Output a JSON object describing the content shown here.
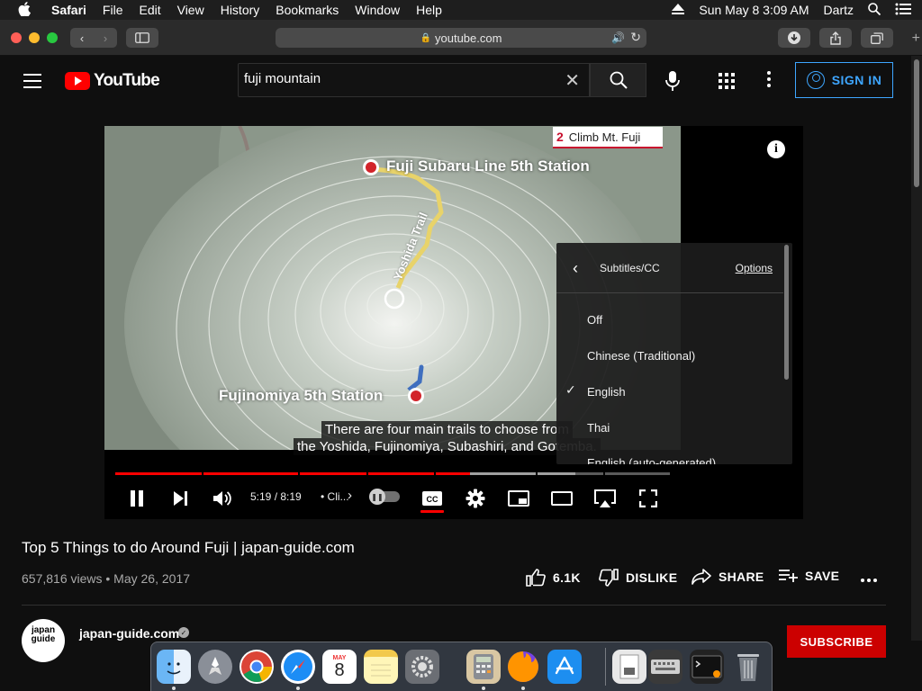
{
  "menubar": {
    "items": [
      "Safari",
      "File",
      "Edit",
      "View",
      "History",
      "Bookmarks",
      "Window",
      "Help"
    ],
    "clock": "Sun May 8  3:09 AM",
    "user": "Dartz"
  },
  "browser": {
    "url": "youtube.com"
  },
  "header": {
    "logo_text": "YouTube",
    "search_value": "fuji mountain",
    "signin_label": "SIGN IN"
  },
  "video": {
    "step_number": "2",
    "step_label": "Climb Mt. Fuji",
    "map_labels": {
      "top_station": "Fuji Subaru Line 5th Station",
      "bottom_station": "Fujinomiya 5th Station",
      "trail": "Yoshida Trail"
    },
    "captions": {
      "line1": "There are four main trails to choose from",
      "line2": "the Yoshida, Fujinomiya, Subashiri, and Gotemba."
    },
    "time": "5:19 / 8:19",
    "chapter": "• Cli...",
    "progress_fraction": 0.64,
    "buffered_fraction": 0.83
  },
  "cc_menu": {
    "title": "Subtitles/CC",
    "options_label": "Options",
    "items": [
      "Off",
      "Chinese (Traditional)",
      "English",
      "Thai",
      "English (auto-generated)"
    ],
    "selected": "English"
  },
  "info": {
    "title": "Top 5 Things to do Around Fuji | japan-guide.com",
    "views": "657,816 views • May 26, 2017",
    "like_count": "6.1K",
    "dislike_label": "DISLIKE",
    "share_label": "SHARE",
    "save_label": "SAVE"
  },
  "channel": {
    "avatar_text": "japan guide",
    "name": "japan-guide.com",
    "subscribe_label": "SUBSCRIBE"
  },
  "dock": {
    "calendar_month": "MAY",
    "calendar_day": "8"
  },
  "colors": {
    "youtube_red": "#ff0000",
    "link_blue": "#3ea6ff",
    "trail_yellow": "#e8d36a",
    "station_red": "#d2232a"
  }
}
